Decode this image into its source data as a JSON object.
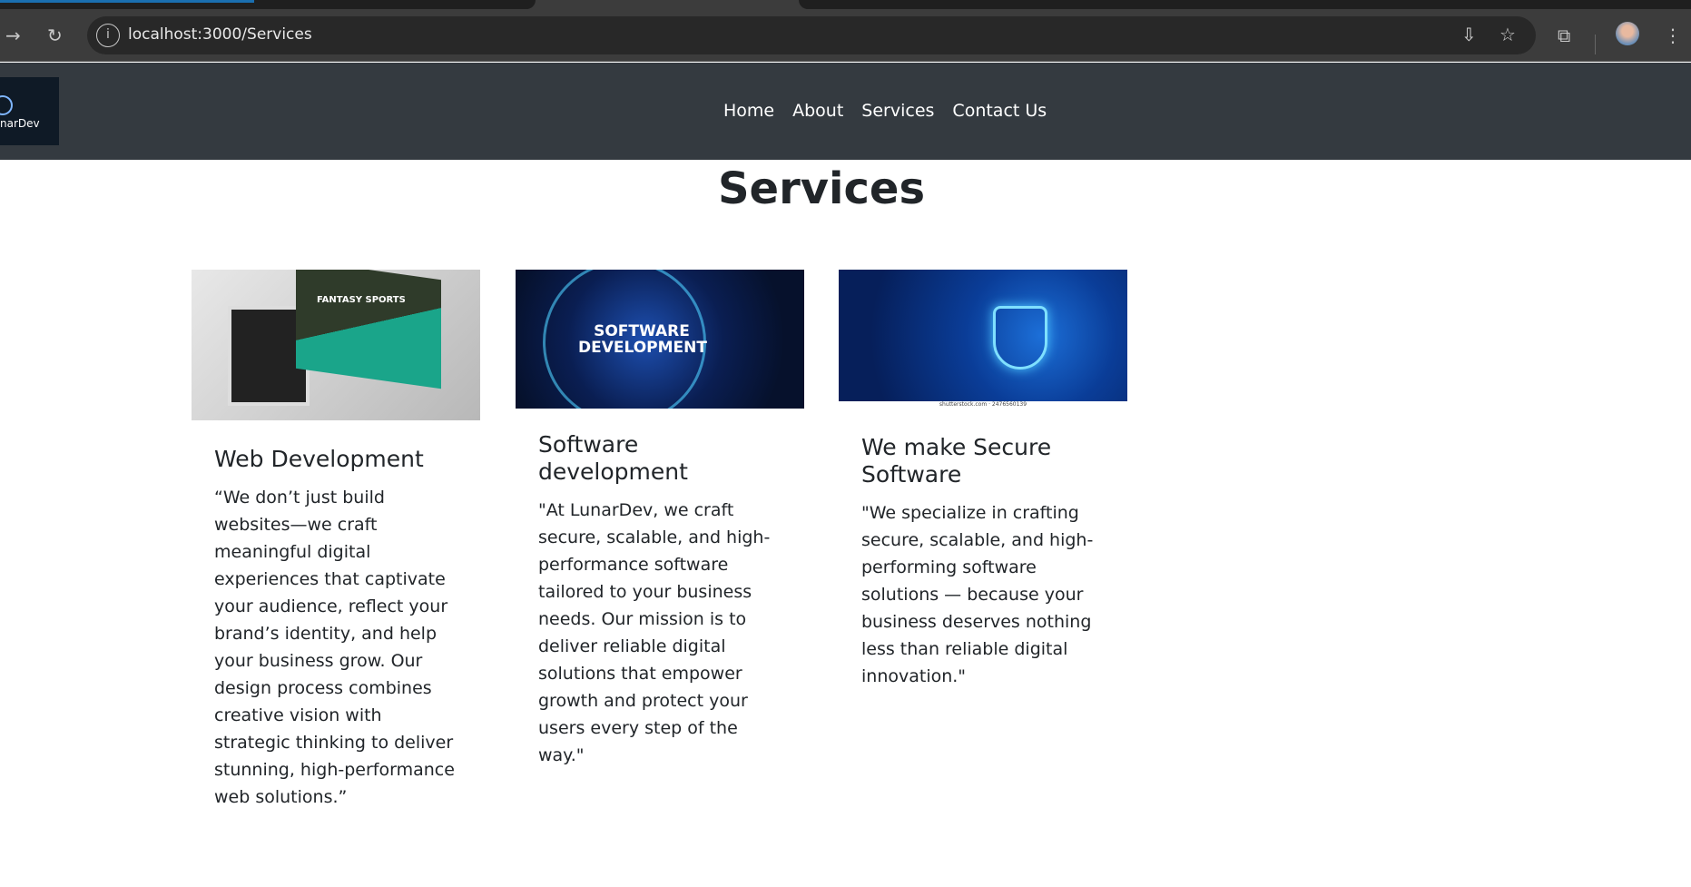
{
  "browser": {
    "url": "localhost:3000/Services"
  },
  "nav": {
    "logo_text": "narDev",
    "links": [
      "Home",
      "About",
      "Services",
      "Contact Us"
    ]
  },
  "page": {
    "title": "Services"
  },
  "cards": [
    {
      "image_text": "FANTASY SPORTS",
      "title": "Web Development",
      "text": "“We don’t just build websites—we craft meaningful digital experiences that captivate your audience, reflect your brand’s identity, and help your business grow. Our design process combines creative vision with strategic thinking to deliver stunning, high-performance web solutions.”"
    },
    {
      "image_text": "SOFTWARE DEVELOPMENT",
      "title": "Software development",
      "text": "\"At LunarDev, we craft secure, scalable, and high-performance software tailored to your business needs. Our mission is to deliver reliable digital solutions that empower growth and protect your users every step of the way.\""
    },
    {
      "image_caption": "shutterstock.com · 2476560139",
      "title": "We make Secure Software",
      "text": "\"We specialize in crafting secure, scalable, and high-performing software solutions — because your business deserves nothing less than reliable digital innovation.\""
    }
  ]
}
